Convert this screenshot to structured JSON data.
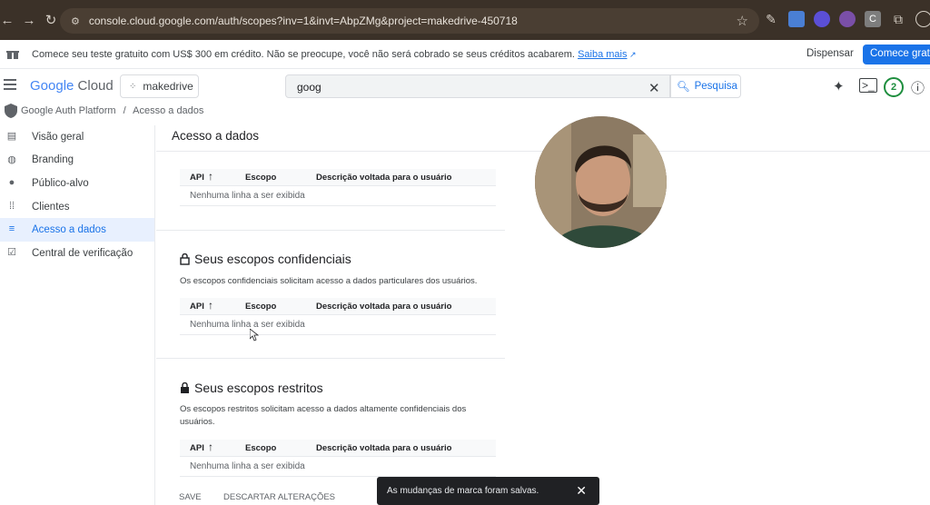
{
  "browser": {
    "url": "console.cloud.google.com/auth/scopes?inv=1&invt=AbpZMg&project=makedrive-450718"
  },
  "banner": {
    "text": "Comece seu teste gratuito com US$ 300 em crédito. Não se preocupe, você não será cobrado se seus créditos acabarem.",
    "link": "Saiba mais",
    "dismiss": "Dispensar",
    "start": "Comece gratu"
  },
  "header": {
    "logo_google": "Google",
    "logo_cloud": "Cloud",
    "project": "makedrive",
    "search_value": "goog",
    "search_button": "Pesquisa",
    "notif_count": "2"
  },
  "breadcrumb": {
    "root": "Google Auth Platform",
    "sep": "/",
    "current": "Acesso a dados"
  },
  "sidebar": {
    "items": [
      {
        "label": "Visão geral",
        "icon": "dashboard-icon"
      },
      {
        "label": "Branding",
        "icon": "palette-icon"
      },
      {
        "label": "Público-alvo",
        "icon": "person-icon"
      },
      {
        "label": "Clientes",
        "icon": "grid-icon"
      },
      {
        "label": "Acesso a dados",
        "icon": "data-access-icon"
      },
      {
        "label": "Central de verificação",
        "icon": "verify-icon"
      }
    ],
    "active_index": 4
  },
  "main": {
    "title": "Acesso a dados",
    "table_headers": {
      "api": "API",
      "scope": "Escopo",
      "desc": "Descrição voltada para o usuário"
    },
    "empty_text": "Nenhuma linha a ser exibida",
    "sensitive_title": "Seus escopos confidenciais",
    "sensitive_desc": "Os escopos confidenciais solicitam acesso a dados particulares dos usuários.",
    "restricted_title": "Seus escopos restritos",
    "restricted_desc": "Os escopos restritos solicitam acesso a dados altamente confidenciais dos usuários.",
    "save": "SAVE",
    "discard": "DESCARTAR ALTERAÇÕES"
  },
  "toast": {
    "message": "As mudanças de marca foram salvas."
  },
  "colors": {
    "accent": "#1a73e8",
    "chrome": "#3b3128"
  }
}
